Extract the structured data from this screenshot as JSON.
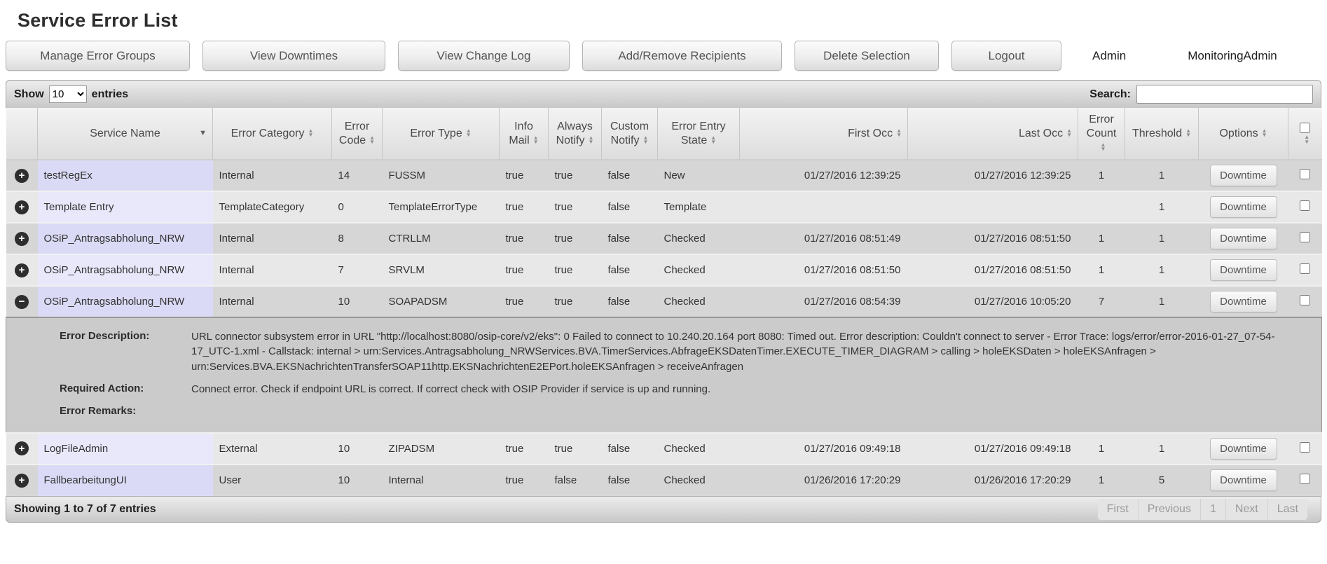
{
  "page": {
    "title": "Service Error List"
  },
  "toolbar": {
    "buttons": [
      "Manage Error Groups",
      "View Downtimes",
      "View Change Log",
      "Add/Remove Recipients",
      "Delete Selection",
      "Logout"
    ],
    "role": "Admin",
    "user": "MonitoringAdmin"
  },
  "table_controls": {
    "show_label": "Show",
    "page_length": "10",
    "entries_label": "entries",
    "search_label": "Search:",
    "search_value": ""
  },
  "table": {
    "columns": [
      {
        "label": "",
        "sort": "none"
      },
      {
        "label": "Service Name",
        "sort": "desc"
      },
      {
        "label": "Error Category",
        "sort": "both"
      },
      {
        "label": "Error Code",
        "sort": "both"
      },
      {
        "label": "Error Type",
        "sort": "both"
      },
      {
        "label": "Info Mail",
        "sort": "both"
      },
      {
        "label": "Always Notify",
        "sort": "both"
      },
      {
        "label": "Custom Notify",
        "sort": "both"
      },
      {
        "label": "Error Entry State",
        "sort": "both"
      },
      {
        "label": "First Occ",
        "sort": "both"
      },
      {
        "label": "Last Occ",
        "sort": "both"
      },
      {
        "label": "Error Count",
        "sort": "both"
      },
      {
        "label": "Threshold",
        "sort": "both"
      },
      {
        "label": "Options",
        "sort": "both"
      },
      {
        "label": "",
        "sort": "both",
        "select_all": true
      }
    ],
    "options_button_label": "Downtime",
    "icons": {
      "expand": "+",
      "collapse": "−"
    },
    "rows": [
      {
        "service_name": "testRegEx",
        "error_category": "Internal",
        "error_code": "14",
        "error_type": "FUSSM",
        "info_mail": "true",
        "always_notify": "true",
        "custom_notify": "false",
        "error_entry_state": "New",
        "first_occ": "01/27/2016 12:39:25",
        "last_occ": "01/27/2016 12:39:25",
        "error_count": "1",
        "threshold": "1",
        "expanded": false
      },
      {
        "service_name": "Template Entry",
        "error_category": "TemplateCategory",
        "error_code": "0",
        "error_type": "TemplateErrorType",
        "info_mail": "true",
        "always_notify": "true",
        "custom_notify": "false",
        "error_entry_state": "Template",
        "first_occ": "",
        "last_occ": "",
        "error_count": "",
        "threshold": "1",
        "expanded": false
      },
      {
        "service_name": "OSiP_Antragsabholung_NRW",
        "error_category": "Internal",
        "error_code": "8",
        "error_type": "CTRLLM",
        "info_mail": "true",
        "always_notify": "true",
        "custom_notify": "false",
        "error_entry_state": "Checked",
        "first_occ": "01/27/2016 08:51:49",
        "last_occ": "01/27/2016 08:51:50",
        "error_count": "1",
        "threshold": "1",
        "expanded": false
      },
      {
        "service_name": "OSiP_Antragsabholung_NRW",
        "error_category": "Internal",
        "error_code": "7",
        "error_type": "SRVLM",
        "info_mail": "true",
        "always_notify": "true",
        "custom_notify": "false",
        "error_entry_state": "Checked",
        "first_occ": "01/27/2016 08:51:50",
        "last_occ": "01/27/2016 08:51:50",
        "error_count": "1",
        "threshold": "1",
        "expanded": false
      },
      {
        "service_name": "OSiP_Antragsabholung_NRW",
        "error_category": "Internal",
        "error_code": "10",
        "error_type": "SOAPADSM",
        "info_mail": "true",
        "always_notify": "true",
        "custom_notify": "false",
        "error_entry_state": "Checked",
        "first_occ": "01/27/2016 08:54:39",
        "last_occ": "01/27/2016 10:05:20",
        "error_count": "7",
        "threshold": "1",
        "expanded": true
      },
      {
        "service_name": "LogFileAdmin",
        "error_category": "External",
        "error_code": "10",
        "error_type": "ZIPADSM",
        "info_mail": "true",
        "always_notify": "true",
        "custom_notify": "false",
        "error_entry_state": "Checked",
        "first_occ": "01/27/2016 09:49:18",
        "last_occ": "01/27/2016 09:49:18",
        "error_count": "1",
        "threshold": "1",
        "expanded": false
      },
      {
        "service_name": "FallbearbeitungUI",
        "error_category": "User",
        "error_code": "10",
        "error_type": "Internal",
        "info_mail": "true",
        "always_notify": "false",
        "custom_notify": "false",
        "error_entry_state": "Checked",
        "first_occ": "01/26/2016 17:20:29",
        "last_occ": "01/26/2016 17:20:29",
        "error_count": "1",
        "threshold": "5",
        "expanded": false
      }
    ],
    "detail": {
      "rows": [
        {
          "label": "Error Description:",
          "value": "URL connector subsystem error in URL \"http://localhost:8080/osip-core/v2/eks\": 0 Failed to connect to 10.240.20.164 port 8080: Timed out. Error description: Couldn't connect to server - Error Trace: logs/error/error-2016-01-27_07-54-17_UTC-1.xml - Callstack: internal > urn:Services.Antragsabholung_NRWServices.BVA.TimerServices.AbfrageEKSDatenTimer.EXECUTE_TIMER_DIAGRAM > calling > holeEKSDaten > holeEKSAnfragen > urn:Services.BVA.EKSNachrichtenTransferSOAP11http.EKSNachrichtenE2EPort.holeEKSAnfragen > receiveAnfragen"
        },
        {
          "label": "Required Action:",
          "value": "Connect error. Check if endpoint URL is correct. If correct check with OSIP Provider if service is up and running."
        },
        {
          "label": "Error Remarks:",
          "value": ""
        }
      ]
    }
  },
  "footer": {
    "info": "Showing 1 to 7 of 7 entries",
    "pagination": [
      "First",
      "Previous",
      "1",
      "Next",
      "Last"
    ]
  }
}
